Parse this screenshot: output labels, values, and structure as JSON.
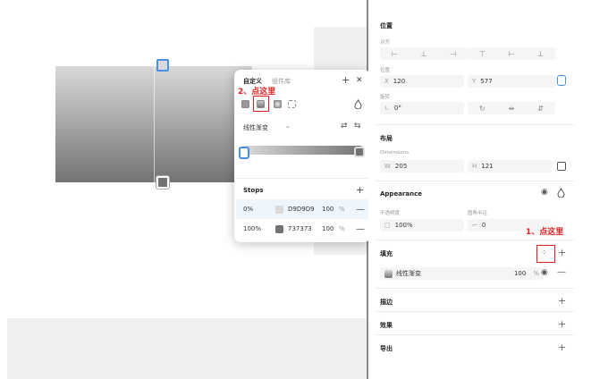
{
  "canvas": {
    "gradient_start": "#D9D9D9",
    "gradient_end": "#737373"
  },
  "popup": {
    "tab_custom": "自定义",
    "tab_library": "组件库",
    "add_symbol": "+",
    "close_symbol": "✕",
    "fill_type_value": "线性渐变",
    "stops_title": "Stops",
    "stops_add_symbol": "+",
    "stops": [
      {
        "position": "0%",
        "hex": "D9D9D9",
        "opacity": "100",
        "unit": "%",
        "color": "#D9D9D9"
      },
      {
        "position": "100%",
        "hex": "737373",
        "opacity": "100",
        "unit": "%",
        "color": "#737373"
      }
    ]
  },
  "annotations": {
    "step2": "2、点这里",
    "step1": "1、点这里",
    "color": "#e02020"
  },
  "panel": {
    "position_title": "位置",
    "align_label": "对齐",
    "pos_label": "位置",
    "x_prefix": "X",
    "x_value": "120",
    "y_prefix": "Y",
    "y_value": "577",
    "rotate_label": "旋转",
    "rotation_prefix": "∟",
    "rotation_value": "0°",
    "layout_title": "布局",
    "dimensions_label": "Dimensions",
    "w_prefix": "W",
    "w_value": "205",
    "h_prefix": "H",
    "h_value": "121",
    "appearance_title": "Appearance",
    "opacity_label": "不透明度",
    "radius_label": "圆角半径",
    "opacity_value": "100%",
    "radius_prefix": "⌐",
    "radius_value": "0",
    "fill_title": "填充",
    "fill_add_symbol": "+",
    "fill_type": "线性渐变",
    "fill_opacity": "100",
    "fill_unit": "%",
    "stroke_title": "描边",
    "effects_title": "效果",
    "export_title": "导出",
    "add_symbol": "+"
  }
}
